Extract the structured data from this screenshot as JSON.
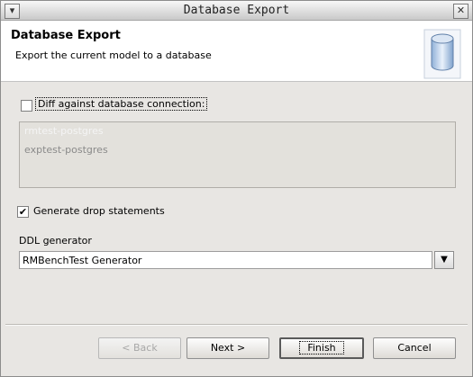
{
  "window": {
    "title": "Database Export"
  },
  "header": {
    "title": "Database Export",
    "description": "Export the current model to a database",
    "icon": "database-icon"
  },
  "diff": {
    "label": "Diff against database connection:",
    "checked": false,
    "connections": [
      "rmtest-postgres",
      "exptest-postgres"
    ]
  },
  "drop": {
    "label": "Generate drop statements",
    "checked": true
  },
  "ddl": {
    "label": "DDL generator",
    "value": "RMBenchTest Generator"
  },
  "buttons": {
    "back": "< Back",
    "next": "Next >",
    "finish": "Finish",
    "cancel": "Cancel"
  }
}
